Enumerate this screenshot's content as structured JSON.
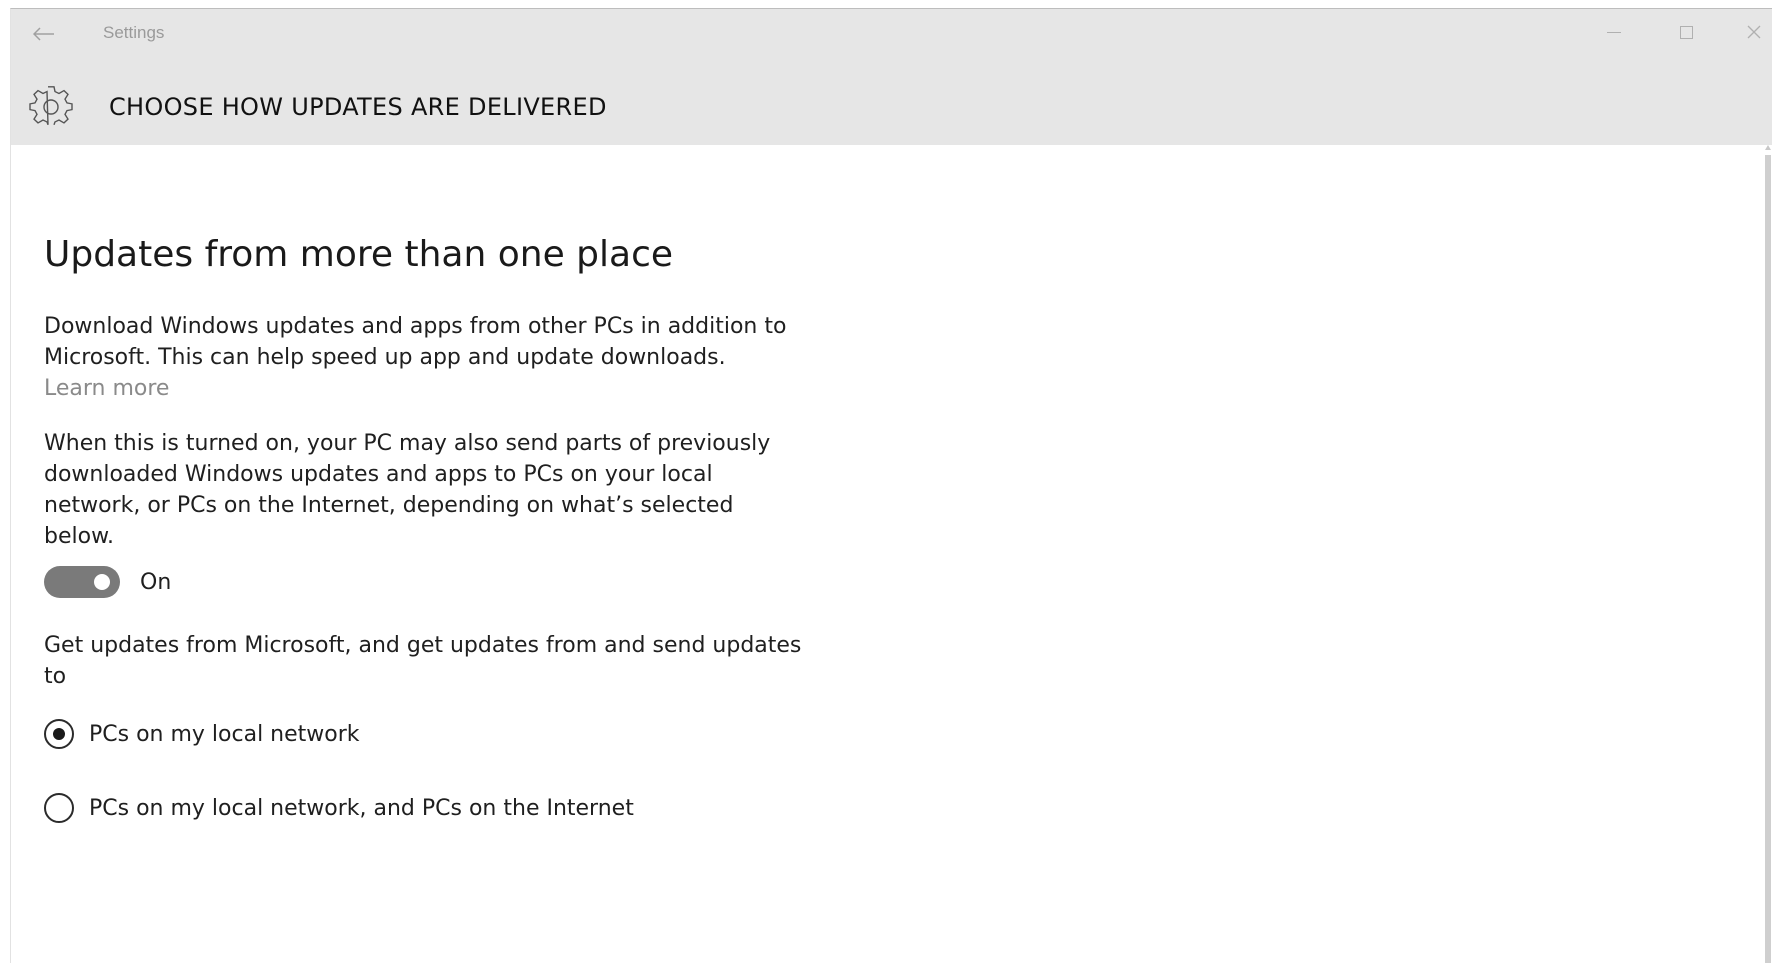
{
  "window": {
    "app_title": "Settings",
    "back_icon": "back-arrow-icon",
    "controls": [
      "minimize-icon",
      "maximize-icon",
      "close-icon"
    ]
  },
  "header": {
    "icon": "gear-icon",
    "title": "CHOOSE HOW UPDATES ARE DELIVERED"
  },
  "section": {
    "title": "Updates from more than one place",
    "description": "Download Windows updates and apps from other PCs in addition to Microsoft. This can help speed up app and update downloads.",
    "learn_more": "Learn more",
    "details": "When this is turned on, your PC may also send parts of previously downloaded Windows updates and apps to PCs on your local network, or PCs on the Internet, depending on what’s selected below.",
    "toggle": {
      "label": "On",
      "state": true
    },
    "options_intro": "Get updates from Microsoft, and get updates from and send updates to",
    "options": [
      {
        "label": "PCs on my local network",
        "selected": true
      },
      {
        "label": "PCs on my local network, and PCs on the Internet",
        "selected": false
      }
    ]
  }
}
